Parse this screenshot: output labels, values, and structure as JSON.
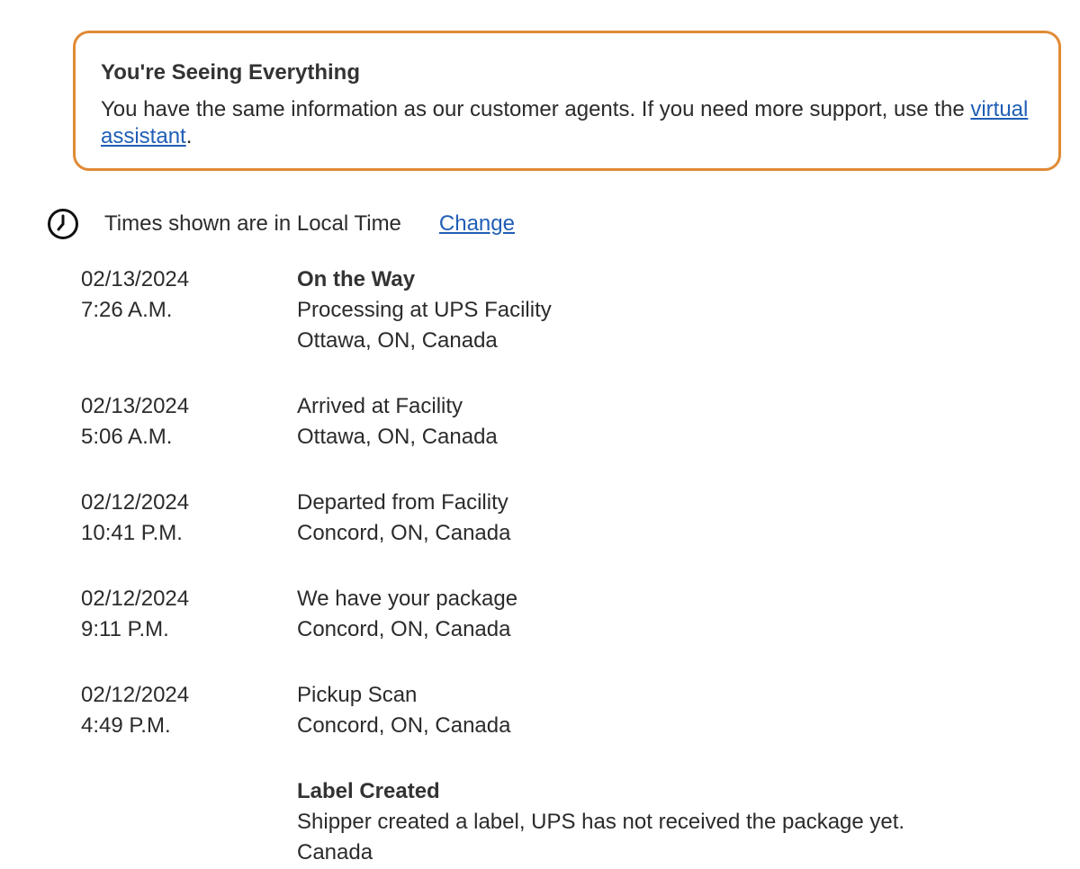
{
  "notice": {
    "title": "You're Seeing Everything",
    "body_prefix": "You have the same information as our customer agents. If you need more support, use the ",
    "link_text": "virtual assistant",
    "body_suffix": "."
  },
  "timezone": {
    "icon": "clock-icon",
    "text": "Times shown are in Local Time",
    "change_label": "Change"
  },
  "events": [
    {
      "date": "02/13/2024",
      "time": "7:26 A.M.",
      "status": "On the Way",
      "detail": "Processing at UPS Facility",
      "location": "Ottawa, ON, Canada"
    },
    {
      "date": "02/13/2024",
      "time": "5:06 A.M.",
      "detail": "Arrived at Facility",
      "location": "Ottawa, ON, Canada"
    },
    {
      "date": "02/12/2024",
      "time": "10:41 P.M.",
      "detail": "Departed from Facility",
      "location": "Concord, ON, Canada"
    },
    {
      "date": "02/12/2024",
      "time": "9:11 P.M.",
      "detail": "We have your package",
      "location": "Concord, ON, Canada"
    },
    {
      "date": "02/12/2024",
      "time": "4:49 P.M.",
      "detail": "Pickup Scan",
      "location": "Concord, ON, Canada"
    },
    {
      "status": "Label Created",
      "detail": "Shipper created a label, UPS has not received the package yet.",
      "location": "Canada"
    }
  ],
  "colors": {
    "notice_border": "#e08a35",
    "link": "#1f5eb5",
    "text": "#2b2b2b"
  }
}
